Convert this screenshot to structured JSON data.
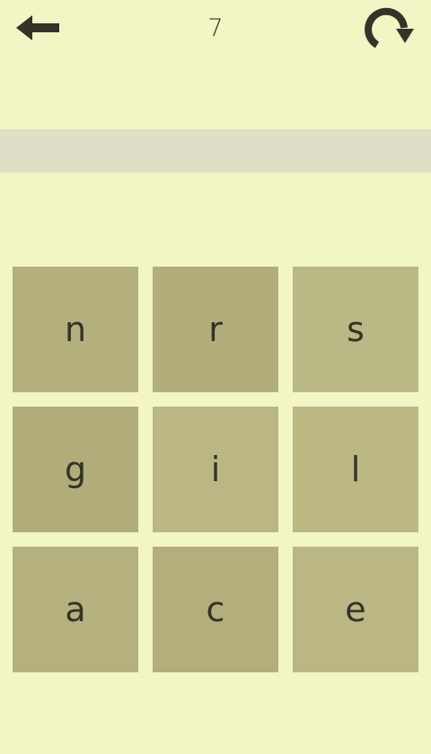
{
  "header": {
    "back_icon": "arrow-left-icon",
    "counter": "7",
    "refresh_icon": "redo-icon"
  },
  "answer": {
    "value": ""
  },
  "tiles": [
    {
      "letter": "n",
      "color": "#b4b07e"
    },
    {
      "letter": "r",
      "color": "#b2ae7c"
    },
    {
      "letter": "s",
      "color": "#bab884"
    },
    {
      "letter": "g",
      "color": "#b1ad7b"
    },
    {
      "letter": "i",
      "color": "#bab784"
    },
    {
      "letter": "l",
      "color": "#bbb884"
    },
    {
      "letter": "a",
      "color": "#b5b17f"
    },
    {
      "letter": "c",
      "color": "#b3ae7c"
    },
    {
      "letter": "e",
      "color": "#bab784"
    }
  ],
  "colors": {
    "background": "#f2f5c4",
    "answer_bar": "#dfdec6",
    "icon": "#333328"
  }
}
